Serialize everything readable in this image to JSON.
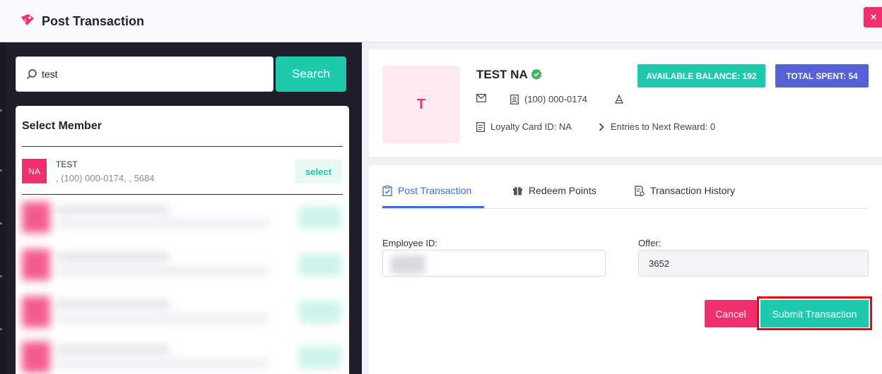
{
  "header": {
    "title": "Post Transaction",
    "close_label": "×"
  },
  "search": {
    "value": "test",
    "button_label": "Search"
  },
  "members": {
    "title": "Select Member",
    "items": [
      {
        "initials": "NA",
        "name": "TEST",
        "details": ", (100) 000-0174, , 5684",
        "select_label": "select"
      }
    ]
  },
  "profile": {
    "initial": "T",
    "name": "TEST NA",
    "phone": "(100) 000-0174",
    "loyalty_card": "Loyalty Card ID: NA",
    "entries": "Entries to Next Reward: 0",
    "available_balance": "AVAILABLE BALANCE: 192",
    "total_spent": "TOTAL SPENT: 54"
  },
  "tabs": [
    {
      "label": "Post Transaction",
      "active": true
    },
    {
      "label": "Redeem Points",
      "active": false
    },
    {
      "label": "Transaction History",
      "active": false
    }
  ],
  "form": {
    "employee_label": "Employee ID:",
    "offer_label": "Offer:",
    "offer_value": "3652",
    "cancel_label": "Cancel",
    "submit_label": "Submit Transaction"
  },
  "colors": {
    "accent_teal": "#1fc9ad",
    "accent_pink": "#f0306e",
    "accent_blue": "#3d6bd8",
    "accent_indigo": "#5661d8",
    "highlight_red": "#e00b16"
  }
}
